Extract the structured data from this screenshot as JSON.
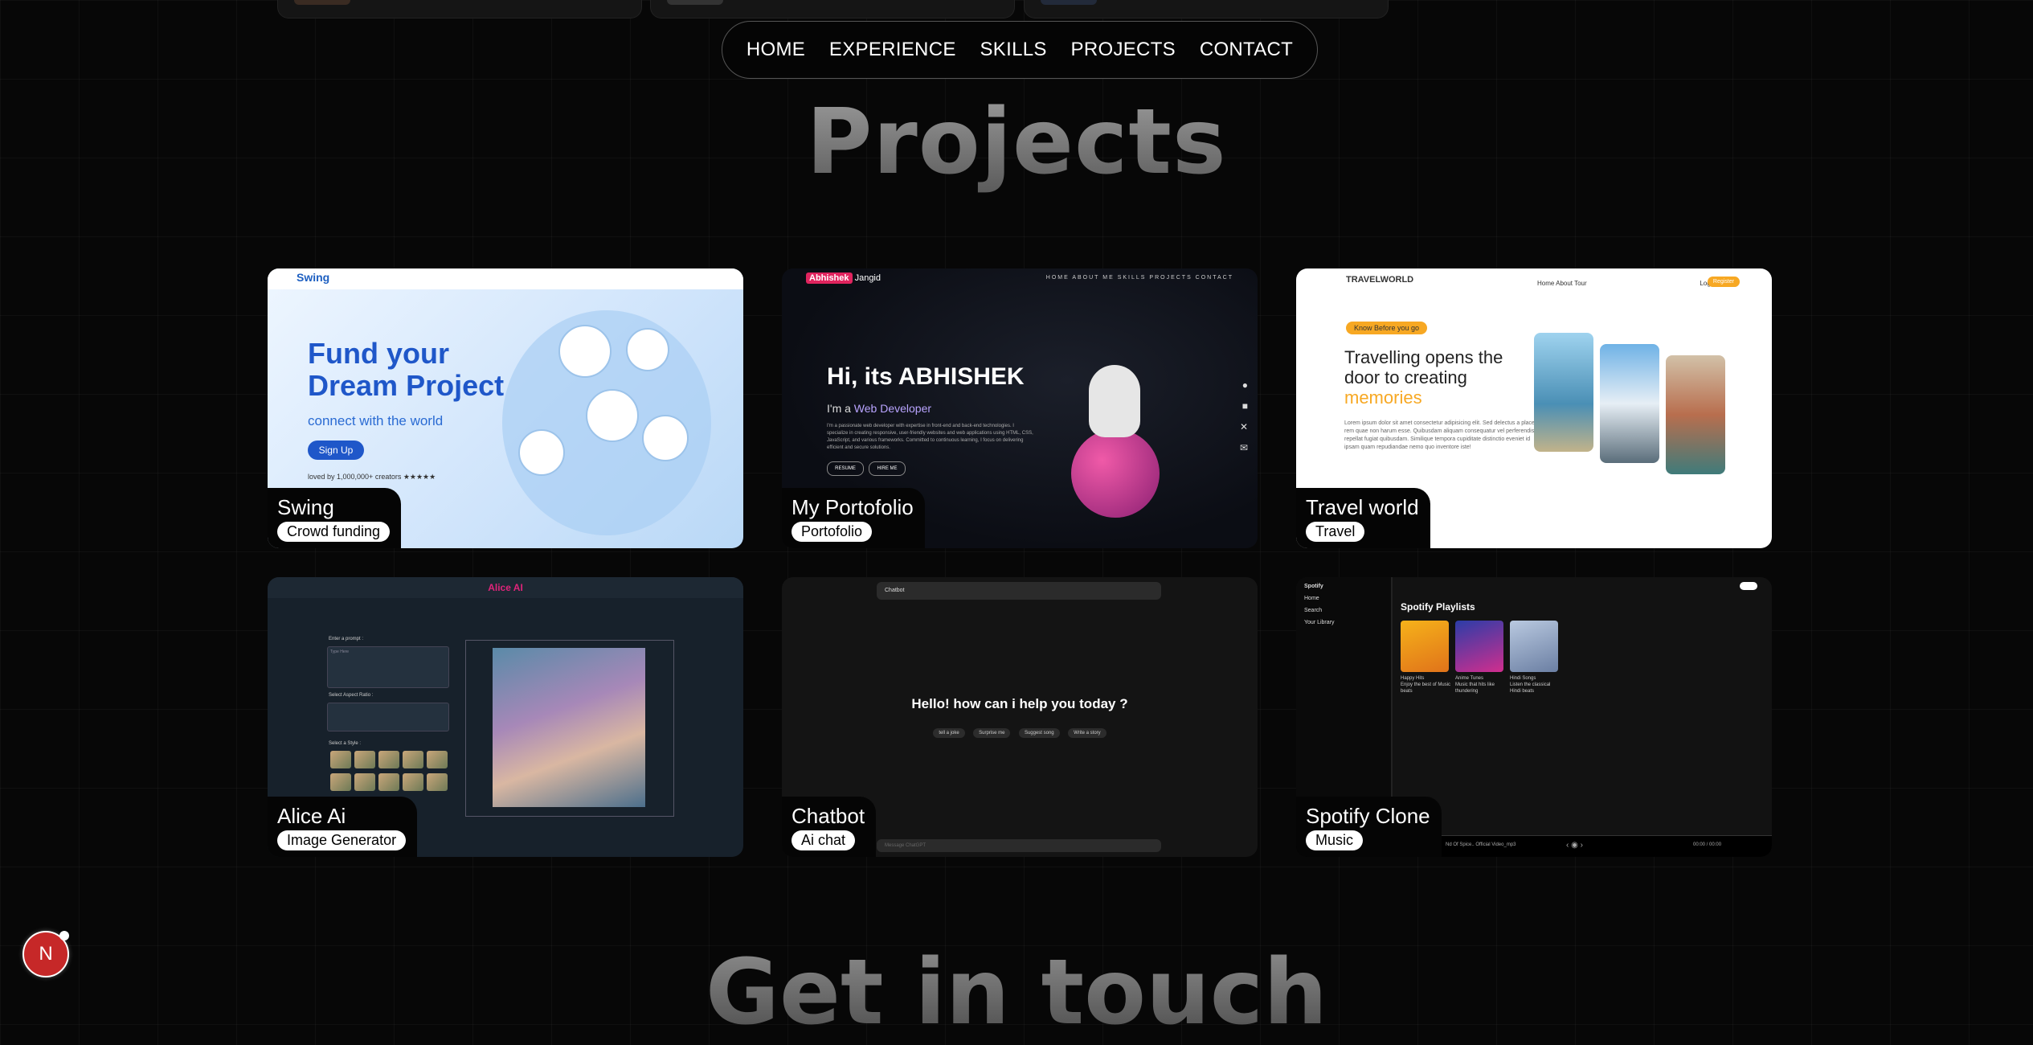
{
  "nav": {
    "items": [
      "HOME",
      "EXPERIENCE",
      "SKILLS",
      "PROJECTS",
      "CONTACT"
    ]
  },
  "section_title": "Projects",
  "next_section_title": "Get in touch",
  "projects": [
    {
      "name": "Swing",
      "tag": "Crowd funding",
      "preview": {
        "logo": "Swing",
        "headline": "Fund your Dream Project",
        "sub": "connect with the world",
        "button": "Sign Up",
        "loved": "loved by 1,000,000+ creators ★★★★★"
      }
    },
    {
      "name": "My Portofolio",
      "tag": "Portofolio",
      "preview": {
        "brand_first": "Abhishek",
        "brand_last": "Jangid",
        "menu": "HOME  ABOUT ME  SKILLS  PROJECTS  CONTACT",
        "hi": "Hi, its ABHISHEK",
        "role_prefix": "I'm a",
        "role": "Web Developer",
        "para": "I'm a passionate web developer with expertise in front-end and back-end technologies. I specialize in creating responsive, user-friendly websites and web applications using HTML, CSS, JavaScript, and various frameworks. Committed to continuous learning, I focus on delivering efficient and secure solutions.",
        "btn1": "RESUME",
        "btn2": "HIRE ME"
      }
    },
    {
      "name": "Travel world",
      "tag": "Travel",
      "preview": {
        "logo": "TRAVELWORLD",
        "links": "Home   About   Tour",
        "login": "Login",
        "register": "Register",
        "badge": "Know Before you go",
        "head1": "Travelling opens the",
        "head2": "door to creating",
        "head3": "memories",
        "para": "Lorem ipsum dolor sit amet consectetur adipisicing elit. Sed delectus a placeat, rem quae non harum esse. Quibusdam aliquam consequatur vel perferendis repellat fugiat quibusdam. Similique tempora cupiditate distinctio eveniet id ipsam quam repudiandae nemo quo inventore iste!"
      }
    },
    {
      "name": "Alice Ai",
      "tag": "Image Generator",
      "preview": {
        "brand": "Alice AI",
        "prompt_label": "Enter a prompt :",
        "prompt_placeholder": "Type Here",
        "ratio_label": "Select Aspect Ratio :",
        "style_label": "Select a Style :"
      }
    },
    {
      "name": "Chatbot",
      "tag": "Ai chat",
      "preview": {
        "model": "Chatbot",
        "question": "Hello! how can i help you today ?",
        "chips": [
          "tell a joke",
          "Surprise me",
          "Suggest song",
          "Write a story"
        ],
        "input_placeholder": "Message ChatGPT"
      }
    },
    {
      "name": "Spotify Clone",
      "tag": "Music",
      "preview": {
        "brand": "Spotify",
        "side": [
          "Home",
          "Search",
          "Your Library"
        ],
        "title": "Spotify Playlists",
        "tiles": [
          {
            "name": "Happy Hits",
            "desc": "Enjoy the best of Music beats"
          },
          {
            "name": "Anime Tunes",
            "desc": "Music that hits like thundering"
          },
          {
            "name": "Hindi Songs",
            "desc": "Listen the classical Hindi beats"
          }
        ],
        "now_playing": "Nd Of Spice.. Official Video_mp3",
        "time": "00:00 / 00:00"
      }
    }
  ],
  "fab_letter": "N"
}
